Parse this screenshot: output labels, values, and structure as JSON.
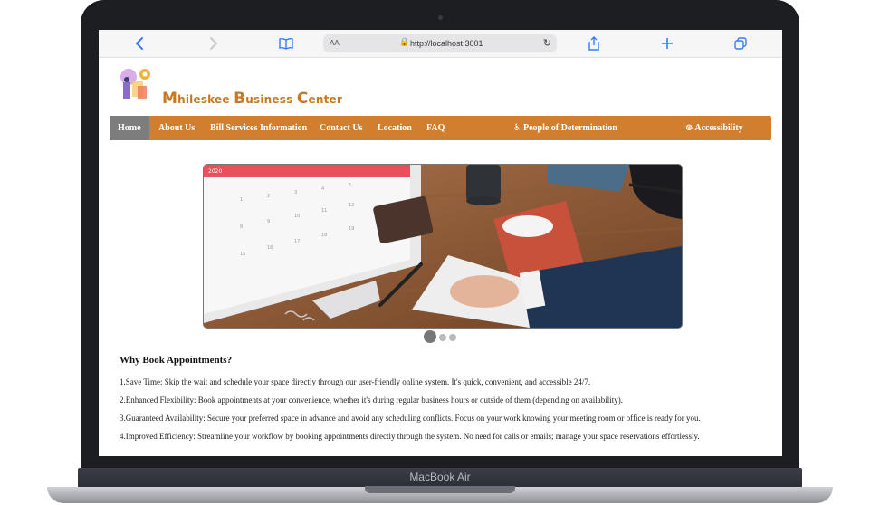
{
  "device": {
    "label": "MacBook Air"
  },
  "browser": {
    "text_size_label": "AA",
    "url": "http://localhost:3001",
    "icons": [
      "chevron-left-icon",
      "chevron-right-icon",
      "book-icon",
      "lock-icon",
      "reload-icon",
      "share-icon",
      "plus-icon",
      "tabs-icon"
    ]
  },
  "site": {
    "title_parts": [
      {
        "cap": "M",
        "rest": "hileskee "
      },
      {
        "cap": "B",
        "rest": "usiness "
      },
      {
        "cap": "C",
        "rest": "enter"
      }
    ]
  },
  "nav": {
    "items": [
      "Home",
      "About Us",
      "Bill Services Information",
      "Contact Us",
      "Location",
      "FAQ"
    ],
    "people": "People of Determination",
    "accessibility": "Accessibility",
    "accent": "#d17f2e",
    "active_bg": "#7d7d7d"
  },
  "carousel": {
    "slide_count": 3,
    "active_index": 0
  },
  "content": {
    "heading": "Why Book Appointments?",
    "points": [
      "1.Save Time: Skip the wait and schedule your space directly through our user-friendly online system. It's quick, convenient, and accessible 24/7.",
      "2.Enhanced Flexibility: Book appointments at your convenience, whether it's during regular business hours or outside of them (depending on availability).",
      "3.Guaranteed Availability: Secure your preferred space in advance and avoid any scheduling conflicts. Focus on your work knowing your meeting room or office is ready for you.",
      "4.Improved Efficiency: Streamline your workflow by booking appointments directly through the system. No need for calls or emails; manage your space reservations effortlessly."
    ]
  }
}
